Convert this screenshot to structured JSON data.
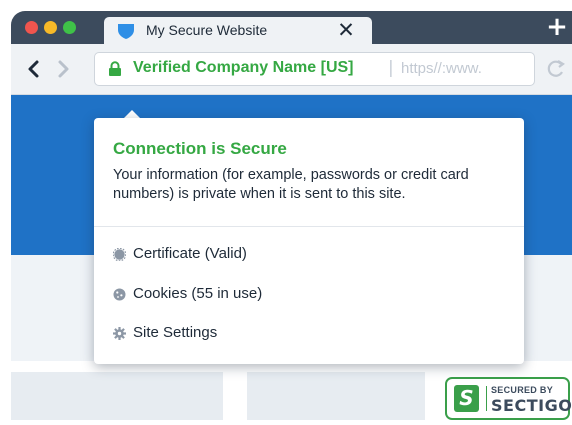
{
  "browser": {
    "tab": {
      "title": "My Secure Website",
      "close_glyph": "✕",
      "favicon": "shield-icon"
    },
    "new_tab_glyph": "+",
    "colors": {
      "chrome": "#3c4b5d",
      "toolbar": "#eff2f5",
      "secure_green": "#35a843",
      "hero_blue": "#1f72c6"
    }
  },
  "address_bar": {
    "lock_icon": "lock-icon",
    "verified_name": "Verified Company Name [US]",
    "separator": "|",
    "url": "https//:www."
  },
  "popup": {
    "title": "Connection is Secure",
    "description": "Your information (for example, passwords or credit card numbers) is private when it is sent to this site.",
    "items": [
      {
        "label": "Certificate (Valid)",
        "icon": "certificate-icon"
      },
      {
        "label": "Cookies (55 in use)",
        "icon": "cookie-icon"
      },
      {
        "label": "Site Settings",
        "icon": "gear-icon"
      }
    ]
  },
  "badge": {
    "letter": "S",
    "top_text": "SECURED BY",
    "brand": "SECTIGO"
  }
}
